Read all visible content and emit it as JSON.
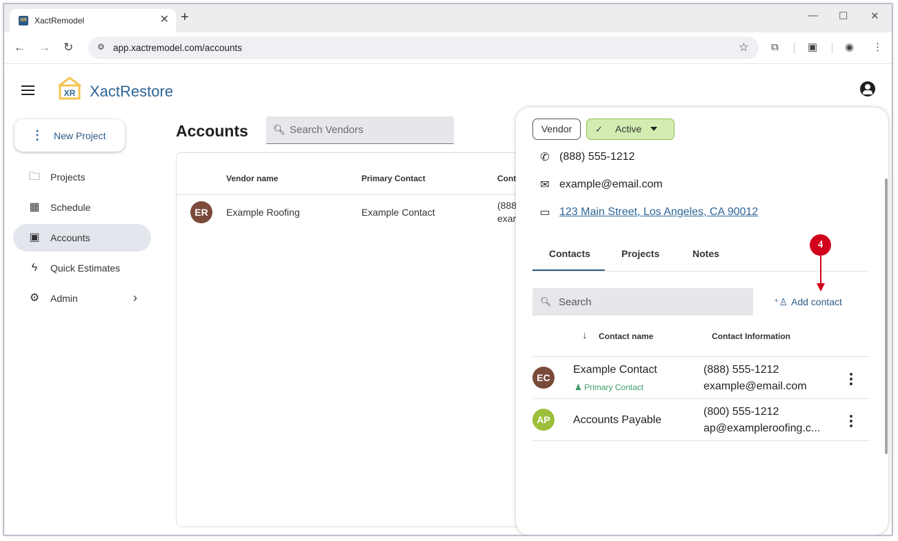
{
  "browser": {
    "tab_title": "XactRemodel",
    "url": "app.xactremodel.com/accounts",
    "favicon_text": "XR"
  },
  "app": {
    "brand": "XactRestore",
    "logo_text": "XR"
  },
  "sidebar": {
    "new_project": "New Project",
    "items": [
      {
        "label": "Projects",
        "icon": "folder-icon"
      },
      {
        "label": "Schedule",
        "icon": "calendar-icon"
      },
      {
        "label": "Accounts",
        "icon": "contact-card-icon",
        "active": true
      },
      {
        "label": "Quick Estimates",
        "icon": "lightning-icon"
      },
      {
        "label": "Admin",
        "icon": "gear-icon"
      }
    ]
  },
  "accounts": {
    "title": "Accounts",
    "search_placeholder": "Search Vendors",
    "columns": [
      "Vendor name",
      "Primary Contact",
      "Cont"
    ],
    "rows": [
      {
        "initials": "ER",
        "vendor": "Example Roofing",
        "contact": "Example Contact",
        "info1": "(888",
        "info2": "exar",
        "avatar_color": "#7a4a3a"
      }
    ]
  },
  "drawer": {
    "type_chip": "Vendor",
    "status_chip": "Active",
    "phone": "(888) 555-1212",
    "email": "example@email.com",
    "address": "123 Main Street, Los Angeles, CA 90012",
    "tabs": [
      "Contacts",
      "Projects",
      "Notes"
    ],
    "active_tab": "Contacts",
    "contact_search_placeholder": "Search",
    "add_contact": "Add contact",
    "columns": [
      "Contact name",
      "Contact Information"
    ],
    "contacts": [
      {
        "initials": "EC",
        "name": "Example Contact",
        "primary_label": "Primary Contact",
        "phone": "(888) 555-1212",
        "email": "example@email.com",
        "avatar_color": "#7a4a3a"
      },
      {
        "initials": "AP",
        "name": "Accounts Payable",
        "primary_label": "",
        "phone": "(800) 555-1212",
        "email": "ap@exampleroofing.c...",
        "avatar_color": "#9bbf3b"
      }
    ]
  },
  "annotation": {
    "callout_number": "4"
  },
  "colors": {
    "brand": "#2d6496",
    "active_chip": "#d4ecb2",
    "callout": "#d0021b",
    "primary_contact": "#3a9a66"
  }
}
